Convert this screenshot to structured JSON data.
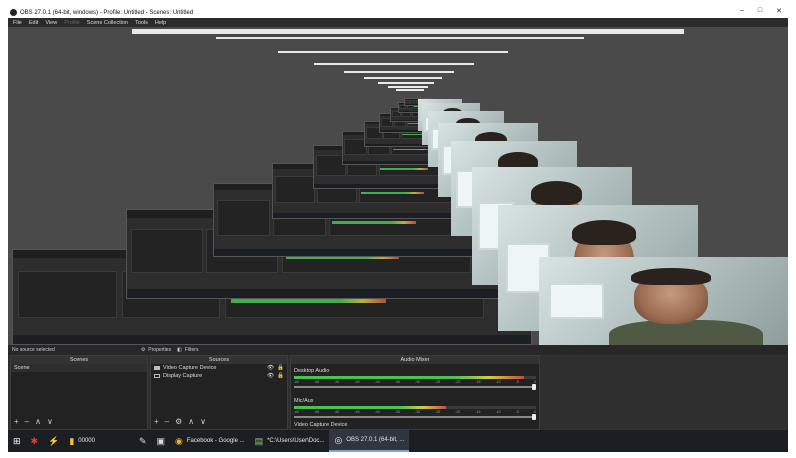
{
  "window": {
    "title": "OBS 27.0.1 (64-bit, windows) - Profile: Untitled - Scenes: Untitled",
    "controls": [
      "–",
      "□",
      "✕"
    ]
  },
  "menu": {
    "items": [
      {
        "label": "File",
        "disabled": false
      },
      {
        "label": "Edit",
        "disabled": false
      },
      {
        "label": "View",
        "disabled": false
      },
      {
        "label": "Profile",
        "disabled": true
      },
      {
        "label": "Scene Collection",
        "disabled": false
      },
      {
        "label": "Tools",
        "disabled": false
      },
      {
        "label": "Help",
        "disabled": false
      }
    ]
  },
  "status": {
    "no_source": "No source selected",
    "properties_label": "Properties",
    "filters_label": "Filters"
  },
  "docks": {
    "scenes": {
      "title": "Scenes",
      "items": [
        "Scene"
      ],
      "tools": [
        "+",
        "–",
        "∧",
        "∨"
      ]
    },
    "sources": {
      "title": "Sources",
      "items": [
        "Video Capture Device",
        "Display Capture"
      ],
      "tools": [
        "+",
        "–",
        "⚙",
        "∧",
        "∨"
      ]
    },
    "mixer": {
      "title": "Audio Mixer",
      "tracks": [
        {
          "name": "Desktop Audio",
          "level": 0.95
        },
        {
          "name": "Mic/Aux",
          "level": 0.63
        }
      ],
      "extra": "Video Capture Device",
      "scale": [
        "-60",
        "-55",
        "-50",
        "-45",
        "-40",
        "-35",
        "-30",
        "-25",
        "-20",
        "-15",
        "-10",
        "-5",
        "0"
      ]
    }
  },
  "taskbar": {
    "items": [
      {
        "label": "",
        "icon": "windows-icon"
      },
      {
        "label": "",
        "icon": "app-red-icon"
      },
      {
        "label": "",
        "icon": "lightning-icon"
      },
      {
        "label": "00000",
        "icon": "folder-icon"
      },
      {
        "label": "",
        "icon": "pen-icon"
      },
      {
        "label": "",
        "icon": "monitor-icon"
      },
      {
        "label": "Facebook - Google ...",
        "icon": "chrome-icon"
      },
      {
        "label": "*C:\\Users\\User\\Doc...",
        "icon": "notepad-icon"
      },
      {
        "label": "OBS 27.0.1 (64-bit, ...",
        "icon": "obs-icon",
        "active": true
      }
    ]
  },
  "colors": {
    "panel_bg": "#2f2f2f",
    "preview_bg": "#4a4a4a",
    "meter_green": "#4bc24c",
    "meter_yellow": "#d4cc3c",
    "meter_red": "#c84c3c",
    "taskbar_bg": "#1b1f24"
  }
}
